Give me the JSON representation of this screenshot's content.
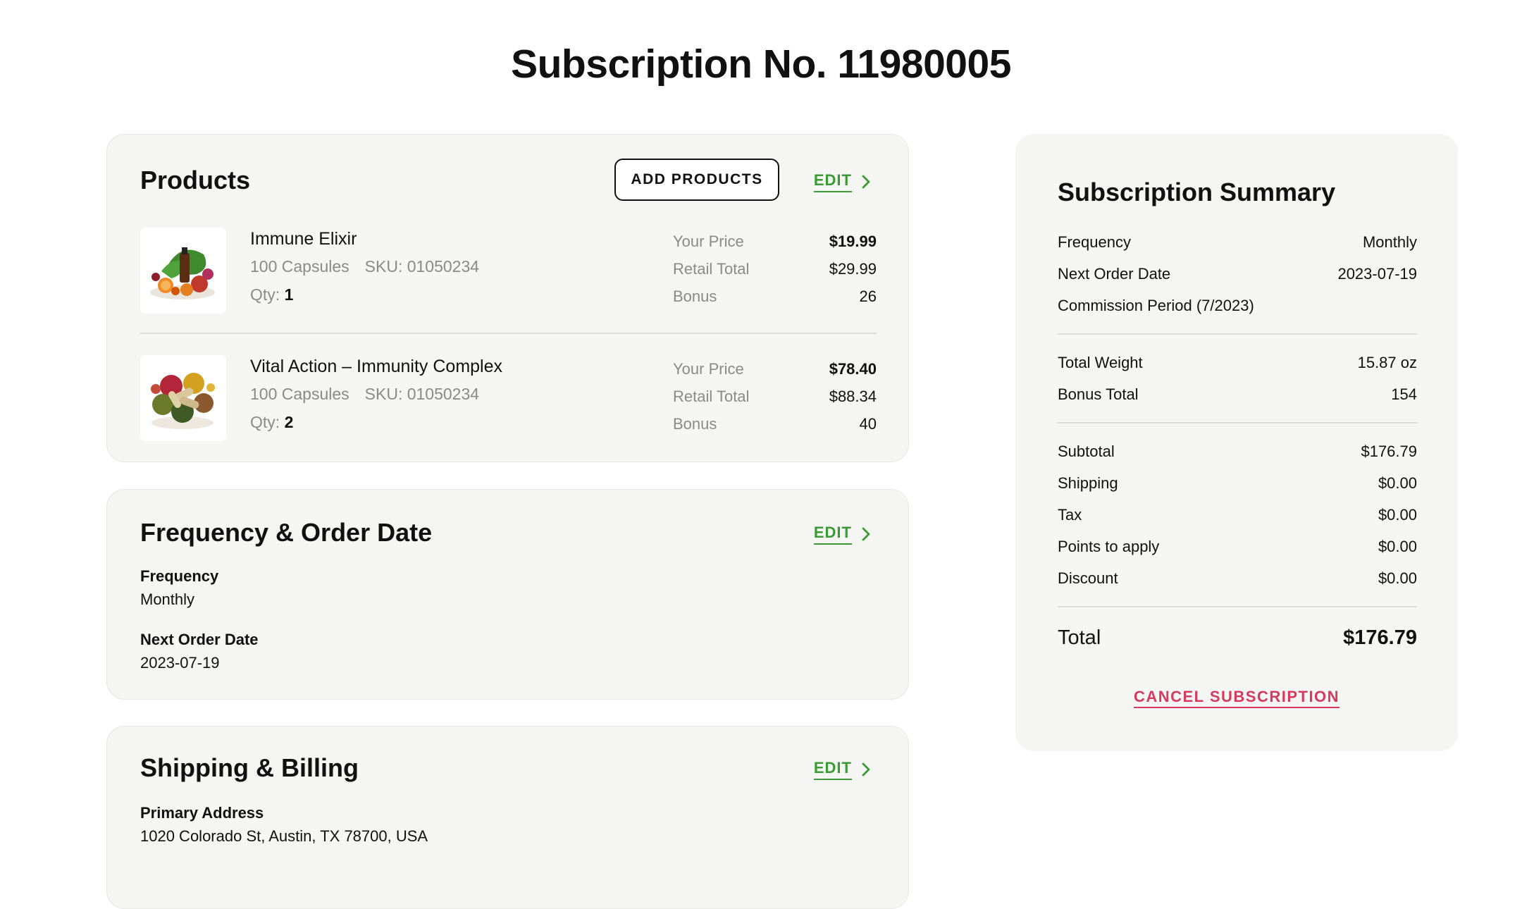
{
  "page": {
    "title": "Subscription No. 11980005"
  },
  "products": {
    "title": "Products",
    "add_label": "ADD PRODUCTS",
    "edit_label": "EDIT",
    "items": [
      {
        "name": "Immune Elixir",
        "size": "100 Capsules",
        "sku": "SKU: 01050234",
        "qty_label": "Qty:",
        "qty": "1",
        "your_price_label": "Your Price",
        "your_price": "$19.99",
        "retail_label": "Retail Total",
        "retail": "$29.99",
        "bonus_label": "Bonus",
        "bonus": "26",
        "icon": "fruits-and-tincture-image"
      },
      {
        "name": "Vital Action – Immunity Complex",
        "size": "100 Capsules",
        "sku": "SKU: 01050234",
        "qty_label": "Qty:",
        "qty": "2",
        "your_price_label": "Your Price",
        "your_price": "$78.40",
        "retail_label": "Retail Total",
        "retail": "$88.34",
        "bonus_label": "Bonus",
        "bonus": "40",
        "icon": "herbs-and-capsules-image"
      }
    ]
  },
  "frequency": {
    "title": "Frequency & Order Date",
    "edit_label": "EDIT",
    "frequency_label": "Frequency",
    "frequency_value": "Monthly",
    "next_label": "Next Order Date",
    "next_value": "2023-07-19"
  },
  "shipping": {
    "title": "Shipping & Billing",
    "edit_label": "EDIT",
    "address_label": "Primary Address",
    "address_value": "1020 Colorado St, Austin, TX 78700, USA"
  },
  "summary": {
    "title": "Subscription Summary",
    "frequency_label": "Frequency",
    "frequency_value": "Monthly",
    "next_label": "Next Order Date",
    "next_value": "2023-07-19",
    "commission_label": "Commission Period (7/2023)",
    "weight_label": "Total Weight",
    "weight_value": "15.87 oz",
    "bonus_label": "Bonus Total",
    "bonus_value": "154",
    "subtotal_label": "Subtotal",
    "subtotal_value": "$176.79",
    "shipping_label": "Shipping",
    "shipping_value": "$0.00",
    "tax_label": "Tax",
    "tax_value": "$0.00",
    "points_label": "Points to apply",
    "points_value": "$0.00",
    "discount_label": "Discount",
    "discount_value": "$0.00",
    "total_label": "Total",
    "total_value": "$176.79",
    "cancel_label": "CANCEL SUBSCRIPTION"
  },
  "colors": {
    "accent_green": "#3a9a34",
    "danger": "#d63b5f",
    "card_bg": "#f5f5f4"
  }
}
